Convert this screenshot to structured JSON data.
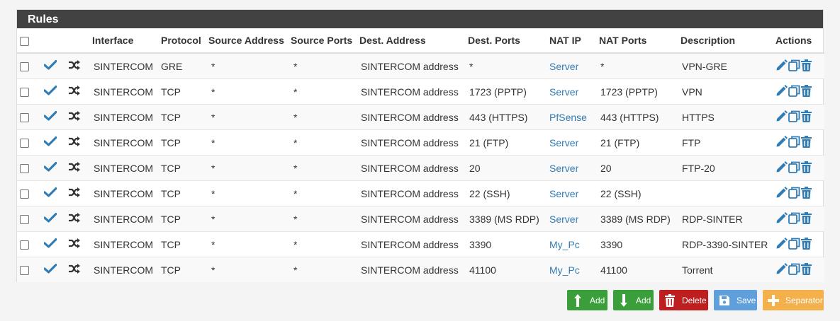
{
  "panel": {
    "title": "Rules"
  },
  "columns": {
    "interface": "Interface",
    "protocol": "Protocol",
    "source_address": "Source Address",
    "source_ports": "Source Ports",
    "dest_address": "Dest. Address",
    "dest_ports": "Dest. Ports",
    "nat_ip": "NAT IP",
    "nat_ports": "NAT Ports",
    "description": "Description",
    "actions": "Actions"
  },
  "rows": [
    {
      "interface": "SINTERCOM",
      "protocol": "GRE",
      "source_address": "*",
      "source_ports": "*",
      "dest_address": "SINTERCOM address",
      "dest_ports": "*",
      "nat_ip": "Server",
      "nat_ports": "*",
      "description": "VPN-GRE"
    },
    {
      "interface": "SINTERCOM",
      "protocol": "TCP",
      "source_address": "*",
      "source_ports": "*",
      "dest_address": "SINTERCOM address",
      "dest_ports": "1723 (PPTP)",
      "nat_ip": "Server",
      "nat_ports": "1723 (PPTP)",
      "description": "VPN"
    },
    {
      "interface": "SINTERCOM",
      "protocol": "TCP",
      "source_address": "*",
      "source_ports": "*",
      "dest_address": "SINTERCOM address",
      "dest_ports": "443 (HTTPS)",
      "nat_ip": "PfSense",
      "nat_ports": "443 (HTTPS)",
      "description": "HTTPS"
    },
    {
      "interface": "SINTERCOM",
      "protocol": "TCP",
      "source_address": "*",
      "source_ports": "*",
      "dest_address": "SINTERCOM address",
      "dest_ports": "21 (FTP)",
      "nat_ip": "Server",
      "nat_ports": "21 (FTP)",
      "description": "FTP"
    },
    {
      "interface": "SINTERCOM",
      "protocol": "TCP",
      "source_address": "*",
      "source_ports": "*",
      "dest_address": "SINTERCOM address",
      "dest_ports": "20",
      "nat_ip": "Server",
      "nat_ports": "20",
      "description": "FTP-20"
    },
    {
      "interface": "SINTERCOM",
      "protocol": "TCP",
      "source_address": "*",
      "source_ports": "*",
      "dest_address": "SINTERCOM address",
      "dest_ports": "22 (SSH)",
      "nat_ip": "Server",
      "nat_ports": "22 (SSH)",
      "description": ""
    },
    {
      "interface": "SINTERCOM",
      "protocol": "TCP",
      "source_address": "*",
      "source_ports": "*",
      "dest_address": "SINTERCOM address",
      "dest_ports": "3389 (MS RDP)",
      "nat_ip": "Server",
      "nat_ports": "3389 (MS RDP)",
      "description": "RDP-SINTER"
    },
    {
      "interface": "SINTERCOM",
      "protocol": "TCP",
      "source_address": "*",
      "source_ports": "*",
      "dest_address": "SINTERCOM address",
      "dest_ports": "3390",
      "nat_ip": "My_Pc",
      "nat_ports": "3390",
      "description": "RDP-3390-SINTER"
    },
    {
      "interface": "SINTERCOM",
      "protocol": "TCP",
      "source_address": "*",
      "source_ports": "*",
      "dest_address": "SINTERCOM address",
      "dest_ports": "41100",
      "nat_ip": "My_Pc",
      "nat_ports": "41100",
      "description": "Torrent"
    }
  ],
  "row_icons": [
    "check-icon",
    "shuffle-icon"
  ],
  "action_icons": [
    "pencil-icon",
    "copy-icon",
    "trash-icon"
  ],
  "buttons": {
    "add_top": {
      "label": "Add",
      "icon": "arrow-up-icon",
      "color": "#3a9e3a"
    },
    "add_bottom": {
      "label": "Add",
      "icon": "arrow-down-icon",
      "color": "#3a9e3a"
    },
    "delete": {
      "label": "Delete",
      "icon": "trash-icon",
      "color": "#bf1e1e"
    },
    "save": {
      "label": "Save",
      "icon": "save-icon",
      "color": "#5fa0dc"
    },
    "separator": {
      "label": "Separator",
      "icon": "plus-icon",
      "color": "#f4b04a"
    }
  },
  "colors": {
    "header_bg": "#424242",
    "link": "#317cb5",
    "icon_blue": "#317cb5"
  }
}
